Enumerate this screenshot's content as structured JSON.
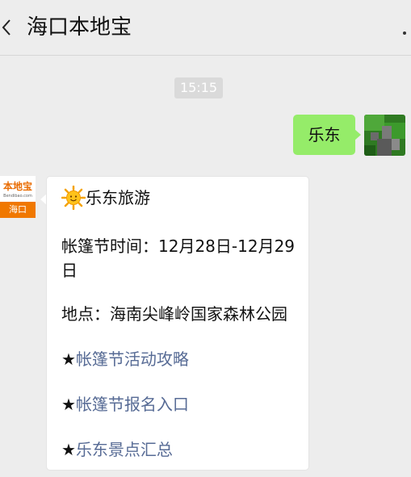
{
  "header": {
    "title": "海口本地宝"
  },
  "chat": {
    "timestamp": "15:15",
    "outgoing": {
      "text": "乐东"
    },
    "incoming": {
      "avatar": {
        "brand": "本地宝",
        "domain": "Bendibao.com",
        "city": "海口"
      },
      "heading": "乐东旅游",
      "time_line": "帐篷节时间：12月28日-12月29日",
      "place_line": "地点：海南尖峰岭国家森林公园",
      "star_symbol": "★",
      "links": [
        "帐篷节活动攻略",
        "帐篷节报名入口",
        "乐东景点汇总"
      ]
    }
  },
  "colors": {
    "background": "#ededed",
    "outgoing_bubble": "#95ec69",
    "link": "#576b95",
    "avatar_accent": "#f07800"
  }
}
